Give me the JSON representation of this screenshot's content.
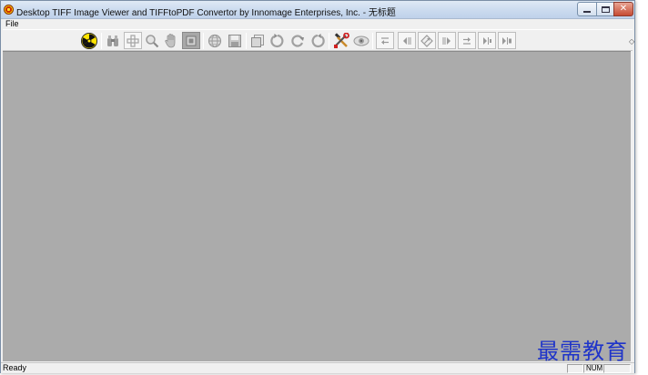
{
  "window": {
    "title": "Desktop TIFF Image Viewer and TIFFtoPDF Convertor by Innomage Enterprises, Inc. - 无标题",
    "app_icon": "radiation-icon"
  },
  "menu": {
    "items": [
      {
        "label": "File"
      }
    ]
  },
  "toolbar": {
    "buttons": [
      {
        "name": "radiation-icon",
        "glyph": "☢"
      },
      {
        "name": "binoculars-icon",
        "glyph": "⚯"
      },
      {
        "name": "zoom-in-icon",
        "glyph": "✚"
      },
      {
        "name": "zoom-magnifier-icon",
        "glyph": "⌕"
      },
      {
        "name": "hand-pan-icon",
        "glyph": "✋"
      },
      {
        "name": "select-rect-icon",
        "glyph": "▣"
      },
      {
        "name": "globe-icon",
        "glyph": "◍"
      },
      {
        "name": "save-disk-icon",
        "glyph": "▤"
      },
      {
        "name": "copy-pages-icon",
        "glyph": "❐"
      },
      {
        "name": "rotate-left-icon",
        "glyph": "↺"
      },
      {
        "name": "rotate-icon",
        "glyph": "⟳"
      },
      {
        "name": "rotate-right-icon",
        "glyph": "↻"
      },
      {
        "name": "tools-icon",
        "glyph": "⚒"
      },
      {
        "name": "eye-icon",
        "glyph": "◉"
      },
      {
        "name": "first-page-icon",
        "glyph": "⇤"
      },
      {
        "name": "previous-page-icon",
        "glyph": "◂"
      },
      {
        "name": "goto-page-icon",
        "glyph": "◇"
      },
      {
        "name": "next-page-icon",
        "glyph": "▸"
      },
      {
        "name": "last-page-icon",
        "glyph": "⇥"
      },
      {
        "name": "play-icon",
        "glyph": "▶"
      },
      {
        "name": "play-end-icon",
        "glyph": "⏭"
      }
    ]
  },
  "status": {
    "text": "Ready",
    "num_indicator": "NUM"
  },
  "watermark": "最需教育"
}
